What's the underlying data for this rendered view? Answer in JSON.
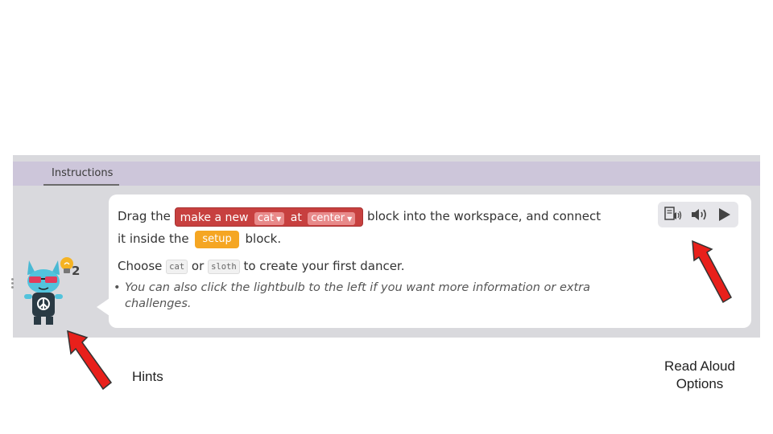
{
  "tab": {
    "label": "Instructions"
  },
  "instruction": {
    "drag_the": "Drag the",
    "block": {
      "make_a_new": "make a new",
      "sprite_option": "cat",
      "at": "at",
      "location_option": "center"
    },
    "into_workspace": "block into the workspace, and connect",
    "it_inside_the": "it inside the",
    "setup_block": "setup",
    "block_word": "block.",
    "choose": "Choose",
    "option_cat": "cat",
    "or": "or",
    "option_sloth": "sloth",
    "to_create": "to create your first dancer.",
    "bullet_text": "You can also click the lightbulb to the left if you want more information or extra challenges."
  },
  "hints": {
    "count": "2"
  },
  "read_aloud": {
    "icons": [
      "read-aloud-settings-icon",
      "speaker-icon",
      "play-icon"
    ]
  },
  "captions": {
    "hints": "Hints",
    "read_aloud_line1": "Read Aloud",
    "read_aloud_line2": "Options"
  },
  "colors": {
    "header": "#cdc6da",
    "panel": "#d9d9dd",
    "block_red": "#c7403f",
    "block_orange": "#f5a623",
    "arrow_red": "#e8201b"
  }
}
